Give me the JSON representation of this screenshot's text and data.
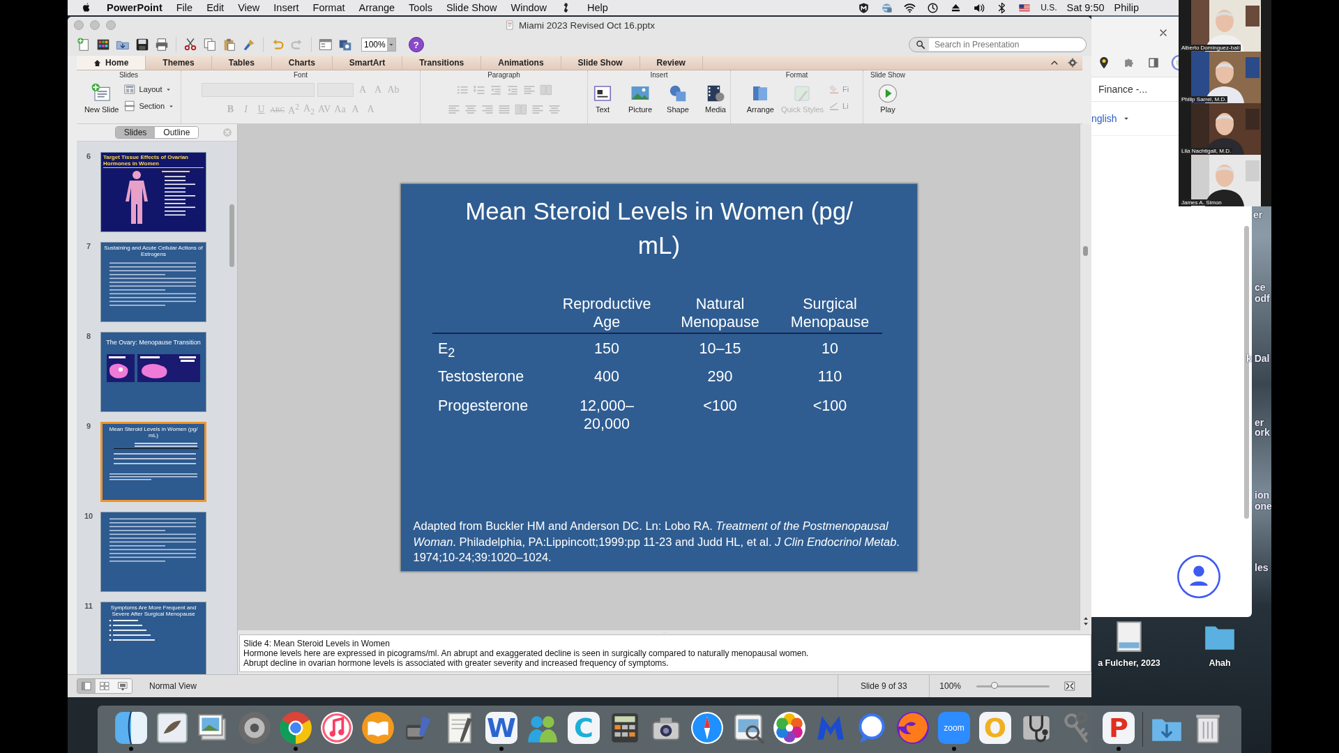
{
  "menu_bar": {
    "app": "PowerPoint",
    "items": [
      {
        "kind": "menu",
        "label": "File"
      },
      {
        "kind": "menu",
        "label": "Edit"
      },
      {
        "kind": "menu",
        "label": "View"
      },
      {
        "kind": "menu",
        "label": "Insert"
      },
      {
        "kind": "menu",
        "label": "Format"
      },
      {
        "kind": "menu",
        "label": "Arrange"
      },
      {
        "kind": "menu",
        "label": "Tools"
      },
      {
        "kind": "menu",
        "label": "Slide Show"
      },
      {
        "kind": "menu",
        "label": "Window"
      },
      {
        "kind": "script"
      },
      {
        "kind": "menu",
        "label": "Help"
      }
    ],
    "input_source": "U.S.",
    "clock": "Sat 9:50",
    "user": "Philip"
  },
  "window": {
    "title": "Miami 2023 Revised Oct 16.pptx",
    "zoom": "100%",
    "help": "?",
    "search": {
      "placeholder": "Search in Presentation"
    }
  },
  "ribbon": {
    "tabs": [
      {
        "label": "Home",
        "selected": true
      },
      {
        "label": "Themes",
        "selected": false
      },
      {
        "label": "Tables",
        "selected": false
      },
      {
        "label": "Charts",
        "selected": false
      },
      {
        "label": "SmartArt",
        "selected": false
      },
      {
        "label": "Transitions",
        "selected": false
      },
      {
        "label": "Animations",
        "selected": false
      },
      {
        "label": "Slide Show",
        "selected": false
      },
      {
        "label": "Review",
        "selected": false
      }
    ],
    "slides_group": {
      "title": "Slides",
      "new_slide": "New Slide",
      "layout": "Layout",
      "section": "Section"
    },
    "font_group": {
      "title": "Font",
      "disabled": true,
      "size_buttons": [
        "A",
        "A",
        "Ab"
      ],
      "style_buttons": [
        "B",
        "I",
        "U",
        "ABC",
        "A$^{2}$",
        "A$_{2}$",
        "AV",
        "Aa",
        "A",
        "A"
      ]
    },
    "paragraph_group": {
      "title": "Paragraph",
      "disabled": true
    },
    "insert_group": {
      "title": "Insert",
      "buttons": [
        "Text",
        "Picture",
        "Shape",
        "Media"
      ]
    },
    "format_group": {
      "title": "Format",
      "buttons": [
        {
          "label": "Arrange",
          "disabled": false
        },
        {
          "label": "Quick Styles",
          "disabled": true
        }
      ],
      "small_buttons": [
        "Fi",
        "Li"
      ]
    },
    "slideshow_group": {
      "title": "Slide Show",
      "buttons": [
        "Play"
      ]
    }
  },
  "sidebar": {
    "tabs": [
      {
        "label": "Slides",
        "selected": true
      },
      {
        "label": "Outline",
        "selected": false
      }
    ],
    "thumbnails": [
      {
        "number": "6",
        "kind": "figure",
        "title": "Target Tissue Effects of Ovarian Hormones in Women",
        "selected": false
      },
      {
        "number": "7",
        "kind": "text",
        "title": "Sustaining and Acute Cellular Actions of Estrogens",
        "selected": false
      },
      {
        "number": "8",
        "kind": "ovary",
        "title": "The Ovary: Menopause Transition",
        "selected": false
      },
      {
        "number": "9",
        "kind": "table",
        "title": "Mean Steroid Levels in Women (pg/ mL)",
        "selected": true
      },
      {
        "number": "10",
        "kind": "text",
        "selected": false
      },
      {
        "number": "11",
        "kind": "bullets",
        "title": "Symptoms Are More Frequent and Severe After Surgical Menopause",
        "selected": false
      }
    ]
  },
  "slide": {
    "title": "Mean Steroid Levels in Women (pg/ mL)",
    "columns": [
      "Reproductive Age",
      "Natural Menopause",
      "Surgical Menopause"
    ],
    "rows": [
      {
        "label": "E$_{2}$",
        "values": [
          "150",
          "10–15",
          "10"
        ]
      },
      {
        "label": "Testosterone",
        "values": [
          "400",
          "290",
          "110"
        ]
      },
      {
        "label": "Progesterone",
        "values": [
          "12,000–20,000",
          "<100",
          "<100"
        ]
      }
    ],
    "citation": "Adapted from Buckler HM and Anderson DC. Ln: Lobo RA. *Treatment of the Postmenopausal Woman*. Philadelphia, PA:Lippincott;1999:pp 11-23 and  Judd HL, et al. *J Clin Endocrinol Metab*. 1974;10-24;39:1020–1024."
  },
  "notes": {
    "lines": [
      "Slide 4: Mean Steroid Levels in Women",
      "Hormone levels here are expressed in picograms/ml. An abrupt and exaggerated decline is seen in surgically compared to naturally menopausal women.",
      "Abrupt decline in ovarian hormone levels is associated with greater severity and increased frequency of symptoms."
    ]
  },
  "status_bar": {
    "view": "Normal View",
    "slide": "Slide 9 of 33",
    "zoom": "100%",
    "zoom_slider": {
      "level": 0.25
    }
  },
  "browser": {
    "link": "Finance -...",
    "language": "nglish"
  },
  "participants": [
    {
      "name": "Alberto Dominguez-bali"
    },
    {
      "name": "Philip Sarrel, M.D."
    },
    {
      "name": "Lila Nachtigall, M.D."
    },
    {
      "name": "James A. Simon"
    }
  ],
  "desktop": {
    "labels": [
      "er",
      "ce",
      "odf",
      "k Dal",
      "er",
      "ork",
      "ion",
      "one",
      "les"
    ],
    "files": [
      {
        "kind": "document",
        "name": "a Fulcher, 2023"
      },
      {
        "kind": "folder",
        "name": "Ahah"
      }
    ]
  },
  "dock": {
    "items": [
      {
        "kind": "finder",
        "running": true
      },
      {
        "kind": "stamp",
        "running": false
      },
      {
        "kind": "photos-stack",
        "running": false
      },
      {
        "kind": "gear",
        "running": false
      },
      {
        "kind": "tricolor",
        "running": true
      },
      {
        "kind": "music",
        "running": false
      },
      {
        "kind": "book",
        "running": false
      },
      {
        "kind": "mailbox",
        "running": false
      },
      {
        "kind": "paper",
        "running": false
      },
      {
        "kind": "letter",
        "label": "W",
        "running": true
      },
      {
        "kind": "people",
        "running": false
      },
      {
        "kind": "letter",
        "label": "C",
        "running": false
      },
      {
        "kind": "calculator",
        "running": false
      },
      {
        "kind": "camera",
        "running": false
      },
      {
        "kind": "compass",
        "running": false
      },
      {
        "kind": "viewer",
        "running": false
      },
      {
        "kind": "flower",
        "running": false
      },
      {
        "kind": "shield",
        "running": false
      },
      {
        "kind": "bubble",
        "running": false
      },
      {
        "kind": "globe",
        "running": false
      },
      {
        "kind": "tile",
        "label": "zoom",
        "running": true
      },
      {
        "kind": "letter",
        "label": "O",
        "running": false
      },
      {
        "kind": "stethoscope",
        "running": false
      },
      {
        "kind": "keys",
        "running": false
      },
      {
        "kind": "letter",
        "label": "P",
        "running": true
      },
      {
        "kind": "divider"
      },
      {
        "kind": "folder",
        "running": false
      },
      {
        "kind": "trash",
        "running": false
      }
    ]
  }
}
